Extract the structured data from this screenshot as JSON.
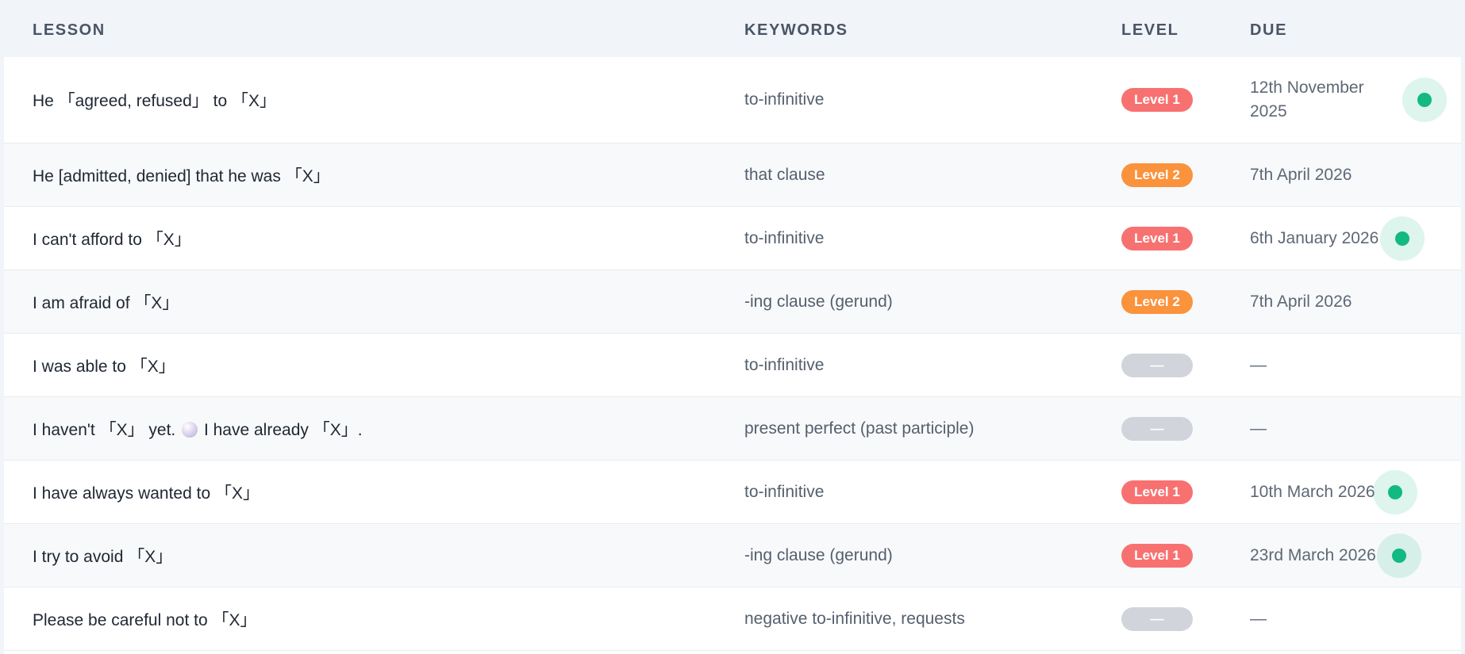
{
  "columns": {
    "lesson": "LESSON",
    "keywords": "KEYWORDS",
    "level": "LEVEL",
    "due": "DUE"
  },
  "colors": {
    "level_1": "#f87171",
    "level_2": "#fb923c",
    "none": "#d1d5db",
    "indicator": "#10b981"
  },
  "rows": [
    {
      "lesson": "He 「agreed, refused」 to 「X」",
      "keywords": "to-infinitive",
      "level": "Level 1",
      "due_line1": "12th November",
      "due_line2": "2025",
      "indicator": true
    },
    {
      "lesson": "He [admitted, denied] that he was 「X」",
      "keywords": "that clause",
      "level": "Level 2",
      "due_line1": "7th April 2026",
      "indicator": false
    },
    {
      "lesson": "I can't afford to 「X」",
      "keywords": "to-infinitive",
      "level": "Level 1",
      "due_line1": "6th January 2026",
      "indicator": true
    },
    {
      "lesson": "I am afraid of 「X」",
      "keywords": "-ing clause (gerund)",
      "level": "Level 2",
      "due_line1": "7th April 2026",
      "indicator": false
    },
    {
      "lesson": "I was able to 「X」",
      "keywords": "to-infinitive",
      "level": "—",
      "due_line1": "—",
      "indicator": false
    },
    {
      "lesson_a": "I haven't 「X」 yet.",
      "lesson_b": "I have already 「X」.",
      "keywords": "present perfect (past participle)",
      "level": "—",
      "due_line1": "—",
      "indicator": false
    },
    {
      "lesson": "I have always wanted to 「X」",
      "keywords": "to-infinitive",
      "level": "Level 1",
      "due_line1": "10th March 2026",
      "indicator": true
    },
    {
      "lesson": "I try to avoid 「X」",
      "keywords": "-ing clause (gerund)",
      "level": "Level 1",
      "due_line1": "23rd March 2026",
      "indicator": true
    },
    {
      "lesson": "Please be careful not to 「X」",
      "keywords": "negative to-infinitive, requests",
      "level": "—",
      "due_line1": "—",
      "indicator": false
    }
  ]
}
